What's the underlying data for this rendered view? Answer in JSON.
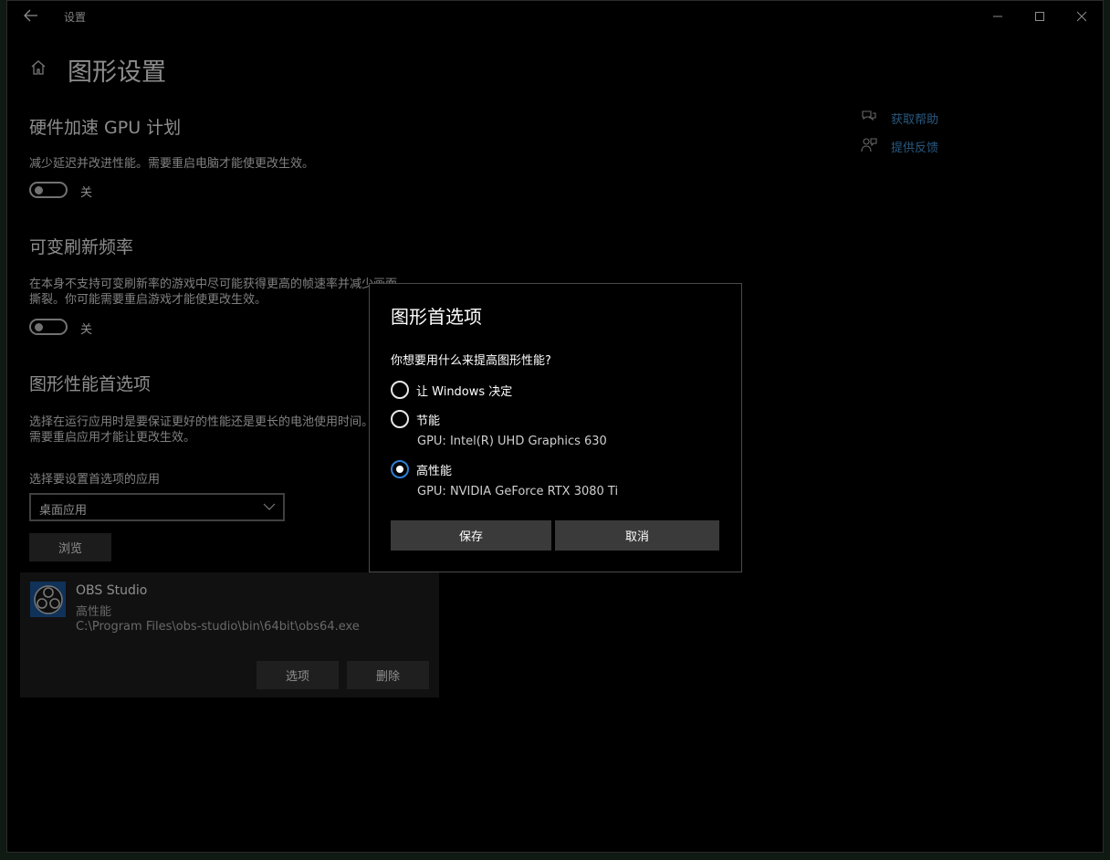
{
  "window": {
    "title": "设置"
  },
  "page": {
    "title": "图形设置"
  },
  "hags": {
    "title": "硬件加速 GPU 计划",
    "desc": "减少延迟并改进性能。需要重启电脑才能使更改生效。",
    "toggle_state": "关"
  },
  "vrr": {
    "title": "可变刷新频率",
    "desc_line1": "在本身不支持可变刷新率的游戏中尽可能获得更高的帧速率并减少画面",
    "desc_line2": "撕裂。你可能需要重启游戏才能使更改生效。",
    "toggle_state": "关"
  },
  "pref": {
    "title": "图形性能首选项",
    "desc_line1": "选择在运行应用时是要保证更好的性能还是更长的电池使用时间。你可能",
    "desc_line2": "需要重启应用才能让更改生效。",
    "select_label": "选择要设置首选项的应用",
    "select_value": "桌面应用",
    "browse_label": "浏览"
  },
  "app": {
    "name": "OBS Studio",
    "mode": "高性能",
    "path": "C:\\Program Files\\obs-studio\\bin\\64bit\\obs64.exe",
    "options_label": "选项",
    "delete_label": "删除"
  },
  "help": {
    "get_help": "获取帮助",
    "feedback": "提供反馈"
  },
  "dialog": {
    "title": "图形首选项",
    "question": "你想要用什么来提高图形性能?",
    "options": [
      {
        "label": "让 Windows 决定",
        "gpu": "",
        "selected": false
      },
      {
        "label": "节能",
        "gpu": "GPU: Intel(R) UHD Graphics 630",
        "selected": false
      },
      {
        "label": "高性能",
        "gpu": "GPU: NVIDIA GeForce RTX 3080 Ti",
        "selected": true
      }
    ],
    "save_label": "保存",
    "cancel_label": "取消"
  },
  "colors": {
    "accent": "#2d7fd4",
    "link": "#4aa0e6",
    "background": "#000000"
  }
}
